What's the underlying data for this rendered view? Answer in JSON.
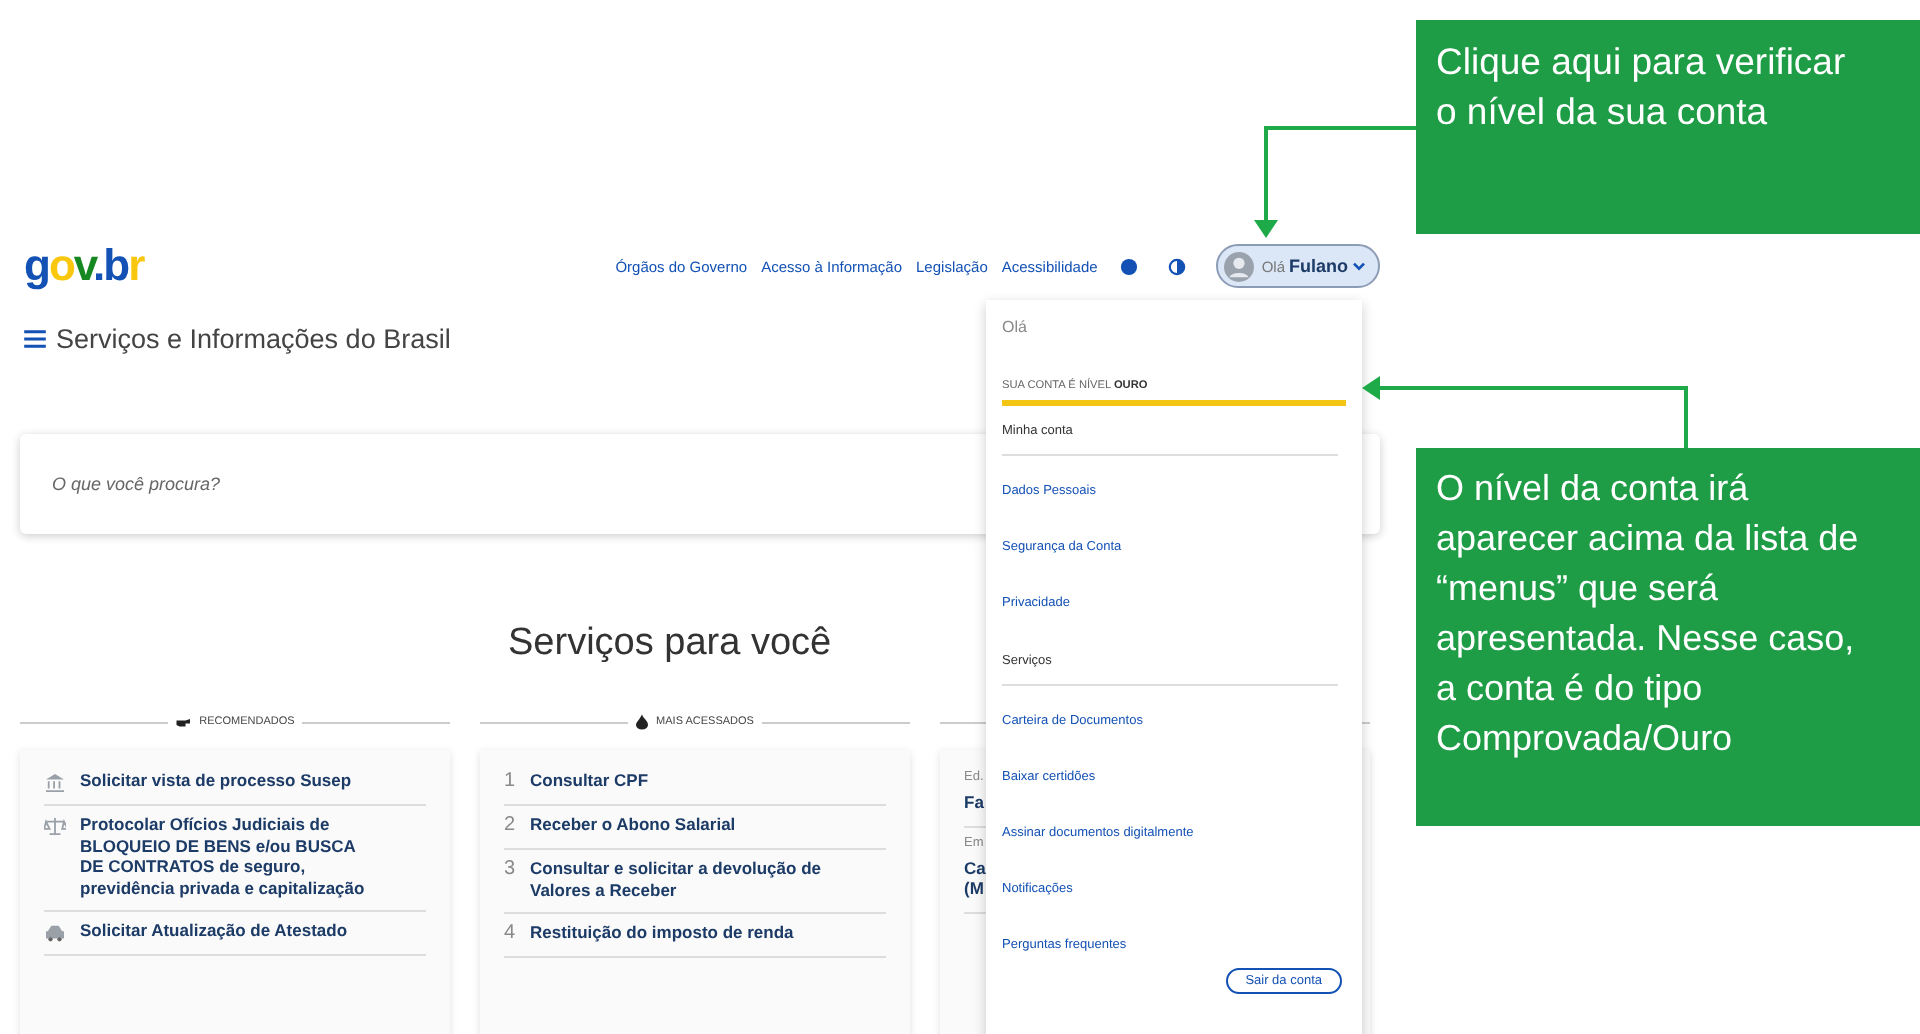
{
  "header": {
    "logo": "gov.br",
    "links": [
      "Órgãos do Governo",
      "Acesso à Informação",
      "Legislação",
      "Acessibilidade"
    ],
    "user": {
      "greeting": "Olá",
      "name": "Fulano"
    }
  },
  "menu_title": "Serviços e Informações do Brasil",
  "search": {
    "placeholder": "O que você procura?"
  },
  "section_title": "Serviços para você",
  "columns": [
    {
      "kind": "icons",
      "heading": "RECOMENDADOS",
      "items": [
        {
          "text": "Solicitar vista de processo Susep"
        },
        {
          "text": "Protocolar Ofícios Judiciais de BLOQUEIO DE BENS e/ou BUSCA DE CONTRATOS de seguro, previdência privada e capitalização"
        },
        {
          "text": "Solicitar Atualização de Atestado"
        }
      ]
    },
    {
      "kind": "ranked",
      "heading": "MAIS ACESSADOS",
      "items": [
        {
          "rank": "1",
          "text": "Consultar CPF"
        },
        {
          "rank": "2",
          "text": "Receber o Abono Salarial"
        },
        {
          "rank": "3",
          "text": "Consultar e solicitar a devolução de Valores a Receber"
        },
        {
          "rank": "4",
          "text": "Restituição do imposto de renda"
        }
      ]
    },
    {
      "kind": "labeled",
      "items": [
        {
          "label": "Ed.",
          "text": "Fa"
        },
        {
          "label": "Em",
          "text": "Ca (M"
        }
      ]
    }
  ],
  "account_menu": {
    "greeting": "Olá",
    "level_label": "SUA CONTA É NÍVEL **OURO**",
    "level": 1,
    "items": [
      {
        "kind": "heading",
        "text": "Minha conta"
      },
      {
        "kind": "link",
        "text": "Dados Pessoais"
      },
      {
        "kind": "link",
        "text": "Segurança da Conta"
      },
      {
        "kind": "link",
        "text": "Privacidade"
      },
      {
        "kind": "heading",
        "text": "Serviços"
      },
      {
        "kind": "link",
        "text": "Carteira de Documentos"
      },
      {
        "kind": "link",
        "text": "Baixar certidões"
      },
      {
        "kind": "link",
        "text": "Assinar documentos digitalmente"
      },
      {
        "kind": "link",
        "text": "Notificações"
      },
      {
        "kind": "link",
        "text": "Perguntas frequentes"
      }
    ],
    "logout": "Sair da conta"
  },
  "callouts": [
    {
      "text": "Clique aqui para verificar o nível da sua conta"
    },
    {
      "text": "O nível da conta irá aparecer acima da lista de “menus” que será apresentada. Nesse caso, a conta é do tipo Comprovada/Ouro"
    }
  ]
}
